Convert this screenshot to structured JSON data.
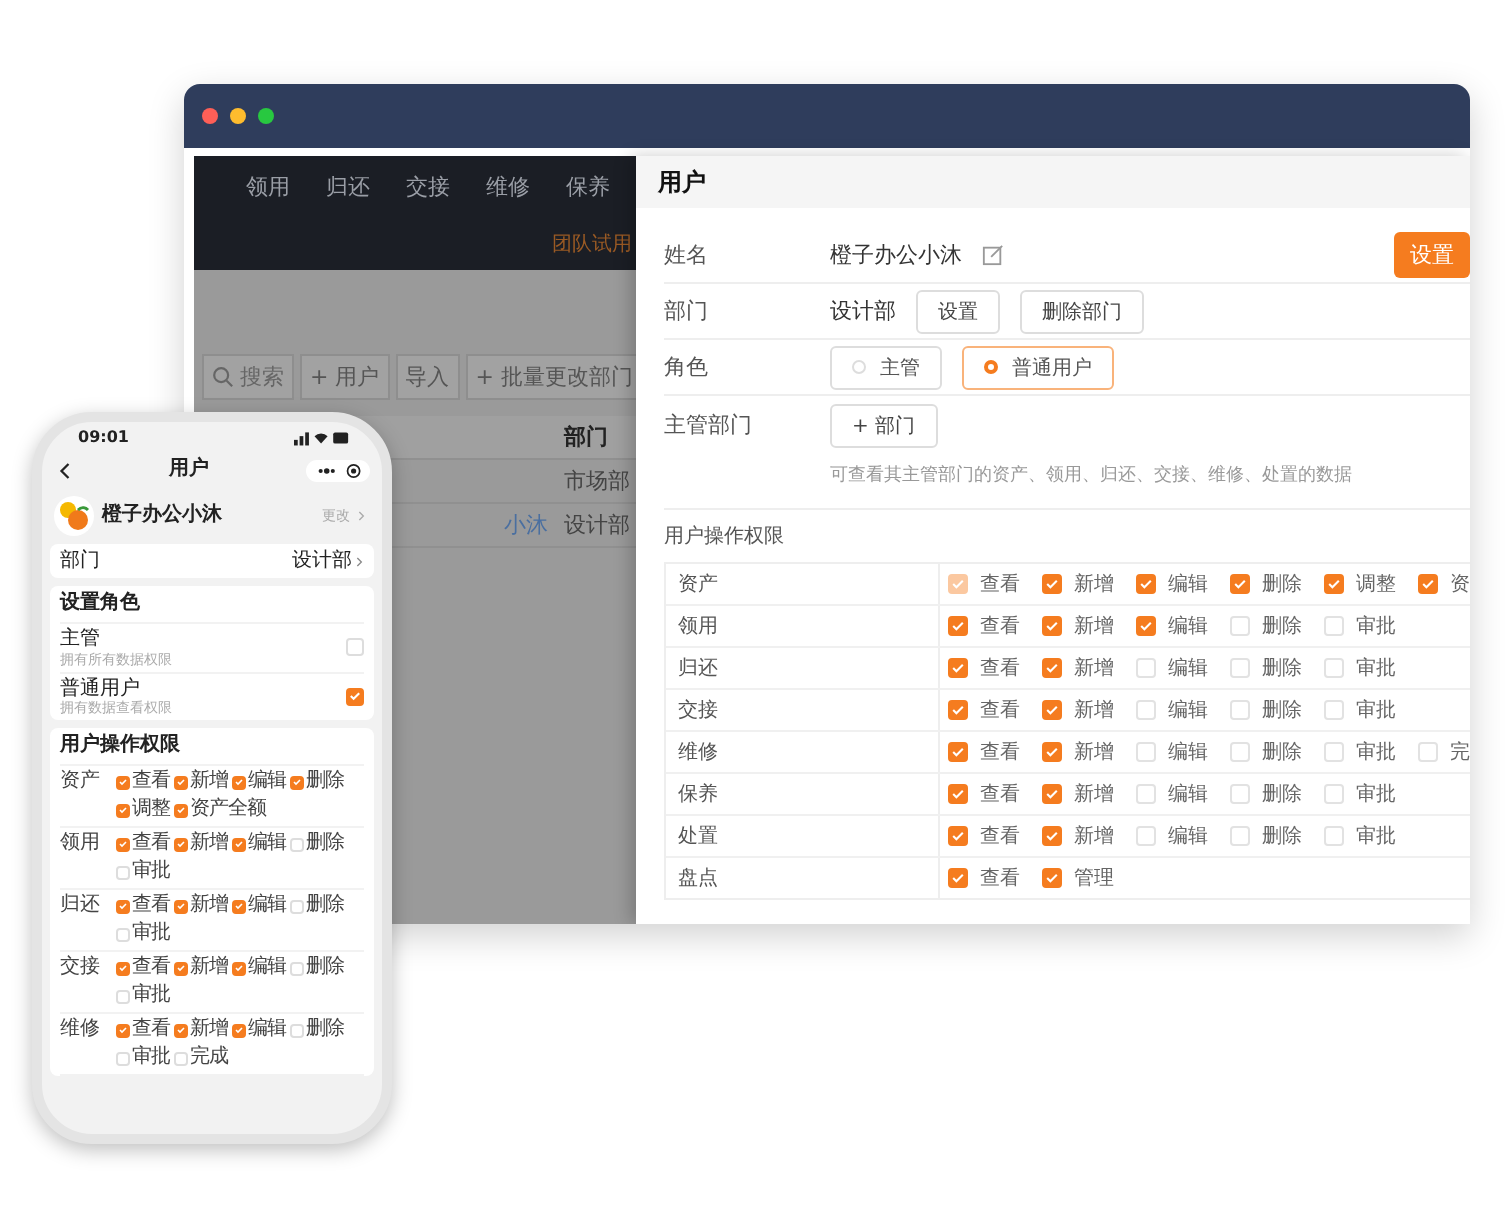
{
  "app": {
    "nav_tabs": [
      "领用",
      "归还",
      "交接",
      "维修",
      "保养"
    ],
    "trial_badge": "团队试用",
    "toolbar": {
      "search_placeholder": "搜索",
      "buttons": [
        "+ 用户",
        "导入",
        "+ 批量更改部门"
      ]
    },
    "table": {
      "header": "部门",
      "rows": [
        {
          "name": "",
          "dept": "市场部"
        },
        {
          "name": "小沐",
          "dept": "设计部"
        }
      ]
    }
  },
  "drawer": {
    "title": "用户",
    "name": {
      "label": "姓名",
      "value": "橙子办公小沐",
      "button": "设置"
    },
    "department": {
      "label": "部门",
      "value": "设计部",
      "buttons": [
        "设置",
        "删除部门"
      ]
    },
    "role": {
      "label": "角色",
      "options": [
        {
          "label": "主管",
          "selected": false
        },
        {
          "label": "普通用户",
          "selected": true
        }
      ]
    },
    "manager_department": {
      "label": "主管部门",
      "button": "+ 部门",
      "hint": "可查看其主管部门的资产、领用、归还、交接、维修、处置的数据"
    },
    "permissions": {
      "title": "用户操作权限",
      "rows": [
        {
          "name": "资产",
          "items": [
            {
              "label": "查看",
              "checked": true,
              "disabled": true
            },
            {
              "label": "新增",
              "checked": true,
              "disabled": false
            },
            {
              "label": "编辑",
              "checked": true,
              "disabled": false
            },
            {
              "label": "删除",
              "checked": true,
              "disabled": false
            },
            {
              "label": "调整",
              "checked": true,
              "disabled": false
            },
            {
              "label": "资",
              "checked": true,
              "disabled": false
            }
          ]
        },
        {
          "name": "领用",
          "items": [
            {
              "label": "查看",
              "checked": true,
              "disabled": false
            },
            {
              "label": "新增",
              "checked": true,
              "disabled": false
            },
            {
              "label": "编辑",
              "checked": true,
              "disabled": false
            },
            {
              "label": "删除",
              "checked": false,
              "disabled": false
            },
            {
              "label": "审批",
              "checked": false,
              "disabled": false
            }
          ]
        },
        {
          "name": "归还",
          "items": [
            {
              "label": "查看",
              "checked": true,
              "disabled": false
            },
            {
              "label": "新增",
              "checked": true,
              "disabled": false
            },
            {
              "label": "编辑",
              "checked": false,
              "disabled": false
            },
            {
              "label": "删除",
              "checked": false,
              "disabled": false
            },
            {
              "label": "审批",
              "checked": false,
              "disabled": false
            }
          ]
        },
        {
          "name": "交接",
          "items": [
            {
              "label": "查看",
              "checked": true,
              "disabled": false
            },
            {
              "label": "新增",
              "checked": true,
              "disabled": false
            },
            {
              "label": "编辑",
              "checked": false,
              "disabled": false
            },
            {
              "label": "删除",
              "checked": false,
              "disabled": false
            },
            {
              "label": "审批",
              "checked": false,
              "disabled": false
            }
          ]
        },
        {
          "name": "维修",
          "items": [
            {
              "label": "查看",
              "checked": true,
              "disabled": false
            },
            {
              "label": "新增",
              "checked": true,
              "disabled": false
            },
            {
              "label": "编辑",
              "checked": false,
              "disabled": false
            },
            {
              "label": "删除",
              "checked": false,
              "disabled": false
            },
            {
              "label": "审批",
              "checked": false,
              "disabled": false
            },
            {
              "label": "完",
              "checked": false,
              "disabled": false
            }
          ]
        },
        {
          "name": "保养",
          "items": [
            {
              "label": "查看",
              "checked": true,
              "disabled": false
            },
            {
              "label": "新增",
              "checked": true,
              "disabled": false
            },
            {
              "label": "编辑",
              "checked": false,
              "disabled": false
            },
            {
              "label": "删除",
              "checked": false,
              "disabled": false
            },
            {
              "label": "审批",
              "checked": false,
              "disabled": false
            }
          ]
        },
        {
          "name": "处置",
          "items": [
            {
              "label": "查看",
              "checked": true,
              "disabled": false
            },
            {
              "label": "新增",
              "checked": true,
              "disabled": false
            },
            {
              "label": "编辑",
              "checked": false,
              "disabled": false
            },
            {
              "label": "删除",
              "checked": false,
              "disabled": false
            },
            {
              "label": "审批",
              "checked": false,
              "disabled": false
            }
          ]
        },
        {
          "name": "盘点",
          "items": [
            {
              "label": "查看",
              "checked": true,
              "disabled": false
            },
            {
              "label": "管理",
              "checked": true,
              "disabled": false
            }
          ]
        }
      ]
    }
  },
  "phone": {
    "time": "09:01",
    "title": "用户",
    "profile": {
      "name": "橙子办公小沐",
      "link": "更改"
    },
    "department": {
      "label": "部门",
      "value": "设计部"
    },
    "role": {
      "title": "设置角色",
      "options": [
        {
          "label": "主管",
          "note": "拥有所有数据权限",
          "selected": false
        },
        {
          "label": "普通用户",
          "note": "拥有数据查看权限",
          "selected": true
        }
      ]
    },
    "permissions": {
      "title": "用户操作权限",
      "rows": [
        {
          "name": "资产",
          "items": [
            {
              "label": "查看",
              "checked": true
            },
            {
              "label": "新增",
              "checked": true
            },
            {
              "label": "编辑",
              "checked": true
            },
            {
              "label": "删除",
              "checked": true
            },
            {
              "label": "调整",
              "checked": true
            },
            {
              "label": "资产全额",
              "checked": true
            }
          ]
        },
        {
          "name": "领用",
          "items": [
            {
              "label": "查看",
              "checked": true
            },
            {
              "label": "新增",
              "checked": true
            },
            {
              "label": "编辑",
              "checked": true
            },
            {
              "label": "删除",
              "checked": false
            },
            {
              "label": "审批",
              "checked": false
            }
          ]
        },
        {
          "name": "归还",
          "items": [
            {
              "label": "查看",
              "checked": true
            },
            {
              "label": "新增",
              "checked": true
            },
            {
              "label": "编辑",
              "checked": true
            },
            {
              "label": "删除",
              "checked": false
            },
            {
              "label": "审批",
              "checked": false
            }
          ]
        },
        {
          "name": "交接",
          "items": [
            {
              "label": "查看",
              "checked": true
            },
            {
              "label": "新增",
              "checked": true
            },
            {
              "label": "编辑",
              "checked": true
            },
            {
              "label": "删除",
              "checked": false
            },
            {
              "label": "审批",
              "checked": false
            }
          ]
        },
        {
          "name": "维修",
          "items": [
            {
              "label": "查看",
              "checked": true
            },
            {
              "label": "新增",
              "checked": true
            },
            {
              "label": "编辑",
              "checked": true
            },
            {
              "label": "删除",
              "checked": false
            },
            {
              "label": "审批",
              "checked": false
            },
            {
              "label": "完成",
              "checked": false
            }
          ]
        }
      ]
    }
  }
}
